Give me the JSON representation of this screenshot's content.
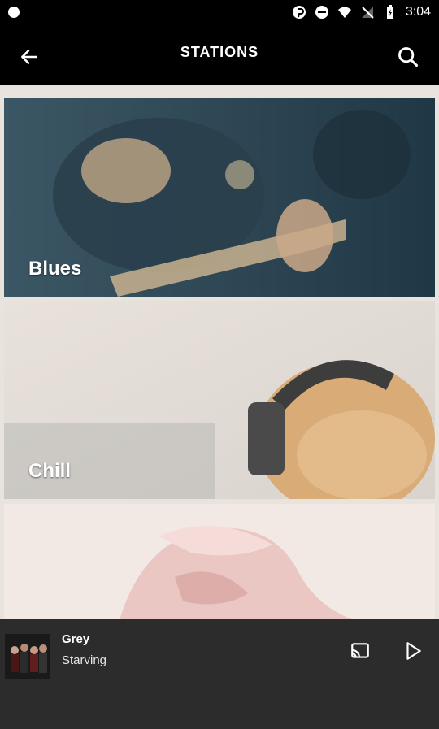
{
  "status_bar": {
    "time": "3:04"
  },
  "toolbar": {
    "title": "STATIONS"
  },
  "stations": [
    {
      "label": "Blues"
    },
    {
      "label": "Chill"
    },
    {
      "label": ""
    }
  ],
  "now_playing": {
    "title": "Grey",
    "subtitle": "Starving"
  },
  "colors": {
    "background": "#000000",
    "player_bg": "#2c2c2c",
    "accent": "#ffffff"
  }
}
